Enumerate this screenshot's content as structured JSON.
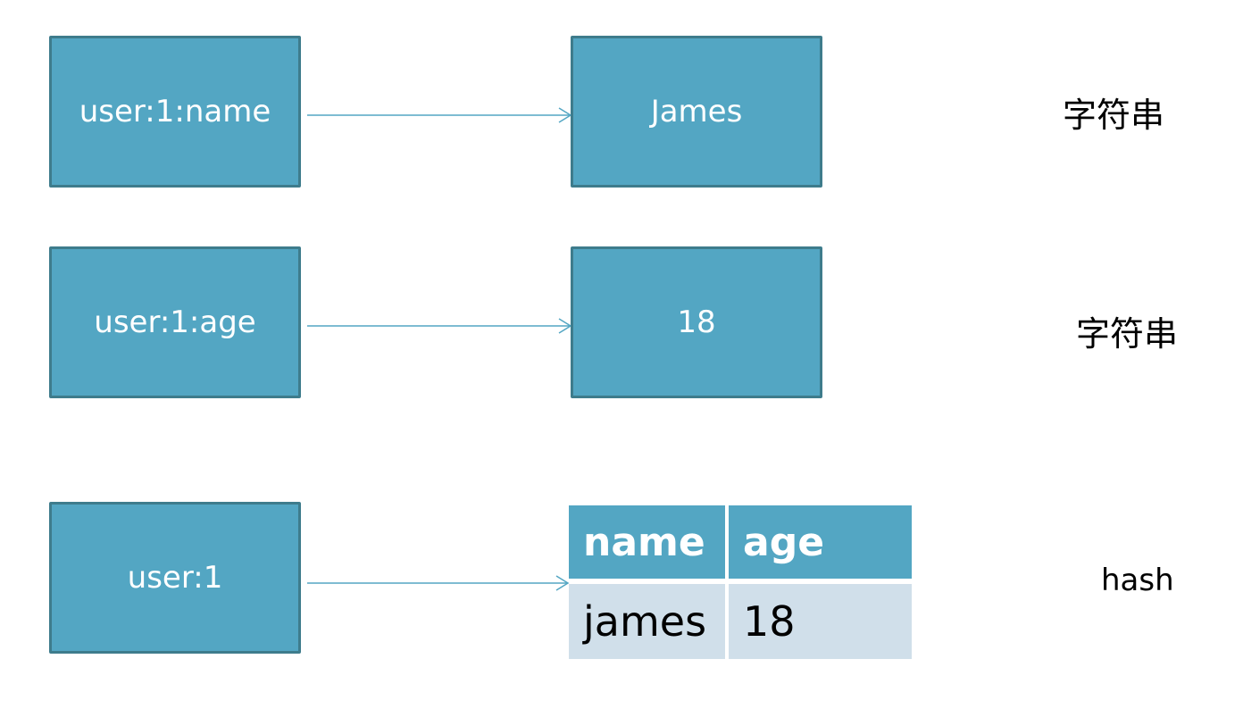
{
  "rows": [
    {
      "key": "user:1:name",
      "value": "James",
      "type": "字符串"
    },
    {
      "key": "user:1:age",
      "value": "18",
      "type": "字符串"
    },
    {
      "key": "user:1",
      "type": "hash",
      "table": {
        "headers": [
          "name",
          "age"
        ],
        "values": [
          "james",
          "18"
        ]
      }
    }
  ],
  "colors": {
    "box_fill": "#53a6c3",
    "box_border": "#3e7c8c",
    "table_row": "#d0dfea",
    "arrow": "#53a6c3"
  }
}
